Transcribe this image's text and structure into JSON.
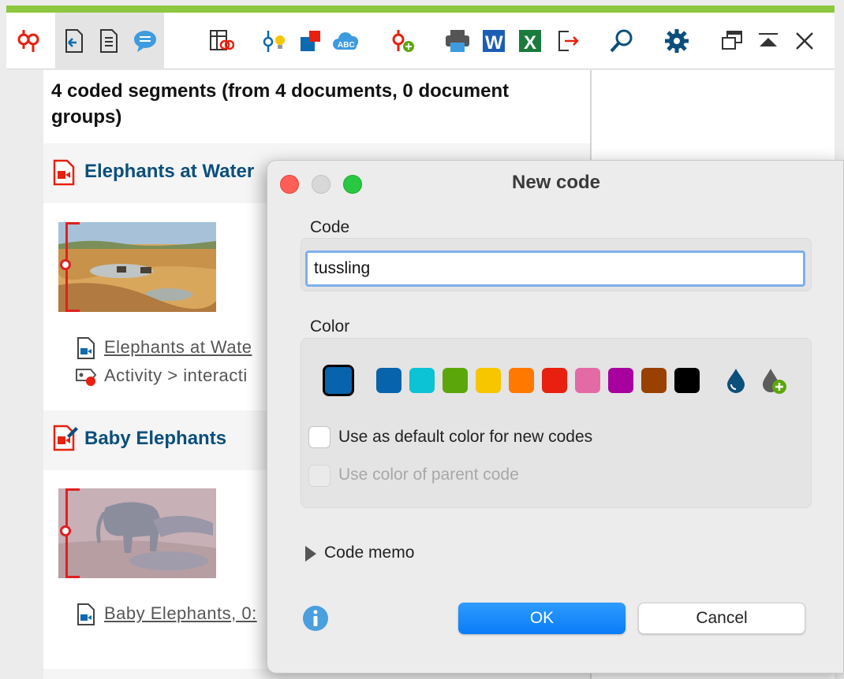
{
  "toolbar": {
    "buttons": [
      "code-system-icon",
      "export-to-document-icon",
      "list-view-icon",
      "comments-icon",
      "coding-table-icon",
      "code-ideas-icon",
      "color-code-icon",
      "word-cloud-icon",
      "new-code-icon",
      "print-icon",
      "word-export-icon",
      "excel-export-icon",
      "export-icon",
      "search-icon",
      "settings-icon",
      "undock-window-icon",
      "collapse-icon",
      "close-icon"
    ]
  },
  "retrieved_segments": {
    "summary": "4 coded segments (from 4 documents, 0 document groups)",
    "documents": [
      {
        "title": "Elephants at Water",
        "link": "Elephants at Wate",
        "code": "Activity > interacti"
      },
      {
        "title": "Baby Elephants",
        "link": "Baby Elephants, 0:"
      }
    ]
  },
  "dialog": {
    "title": "New code",
    "code_label": "Code",
    "code_value": "tussling",
    "color_label": "Color",
    "selected_color": "#0763ac",
    "palette": [
      "#0763ac",
      "#0bc3d4",
      "#5ba70b",
      "#f7c600",
      "#ff7800",
      "#e8200f",
      "#e46aa6",
      "#a7009e",
      "#994100",
      "#000000"
    ],
    "default_color_checkbox": "Use as default color for new codes",
    "parent_color_checkbox": "Use color of parent code",
    "memo_label": "Code memo",
    "ok_label": "OK",
    "cancel_label": "Cancel"
  }
}
